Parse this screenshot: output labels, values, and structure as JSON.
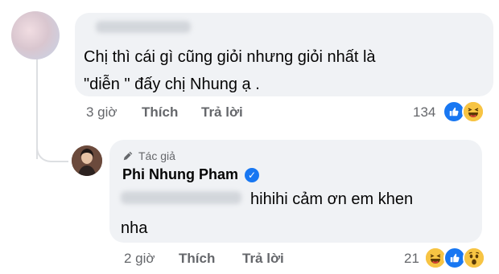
{
  "comment": {
    "text_line1": "Chị thì cái gì cũng giỏi nhưng giỏi nhất là",
    "text_line2": "\"diễn \" đấy chị Nhung ạ .",
    "time": "3 giờ",
    "like_label": "Thích",
    "reply_label": "Trả lời",
    "reaction_count": "134",
    "reactions": [
      "like",
      "haha"
    ]
  },
  "reply": {
    "author_tag": "Tác giả",
    "author_name": "Phi Nhung Pham",
    "text_line1": "hihihi cảm ơn em khen",
    "text_line2": "nha",
    "time": "2 giờ",
    "like_label": "Thích",
    "reply_label": "Trả lời",
    "reaction_count": "21",
    "reactions": [
      "haha",
      "like",
      "wow"
    ]
  },
  "colors": {
    "bubble": "#f0f2f5",
    "meta_text": "#65676b",
    "like_blue": "#1877f2",
    "emoji_yellow": "#f7c443"
  }
}
